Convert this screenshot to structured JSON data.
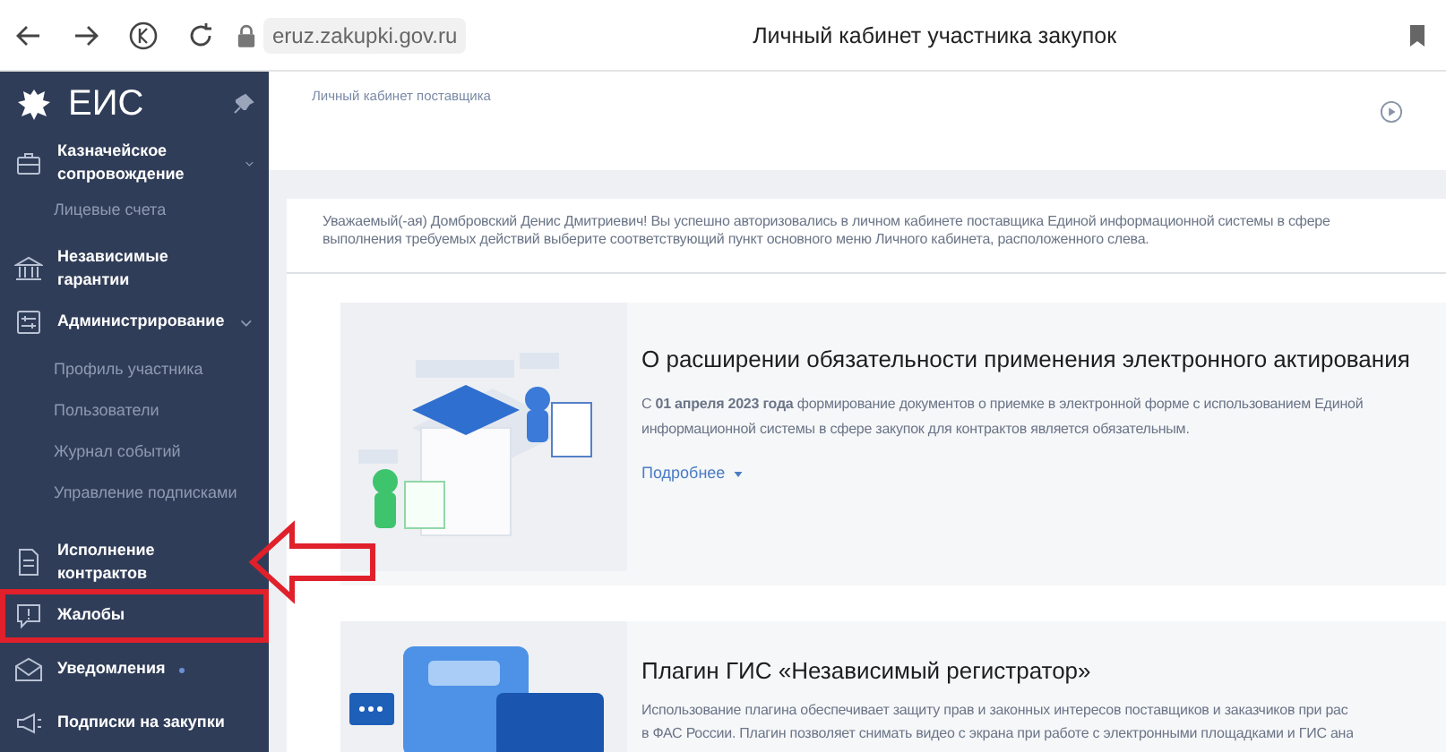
{
  "browser": {
    "url": "eruz.zakupki.gov.ru",
    "title": "Личный кабинет участника закупок"
  },
  "sidebar": {
    "logo": "ЕИС",
    "items": [
      {
        "label": "Казначейское сопровождение",
        "expanded": true,
        "children": [
          {
            "label": "Лицевые счета"
          }
        ]
      },
      {
        "label": "Независимые гарантии"
      },
      {
        "label": "Администрирование",
        "expanded": true,
        "children": [
          {
            "label": "Профиль участника"
          },
          {
            "label": "Пользователи"
          },
          {
            "label": "Журнал событий"
          },
          {
            "label": "Управление подписками"
          }
        ]
      },
      {
        "label": "Исполнение контрактов"
      },
      {
        "label": "Жалобы",
        "highlighted": true
      },
      {
        "label": "Уведомления",
        "unread": true
      },
      {
        "label": "Подписки на закупки"
      }
    ]
  },
  "breadcrumb": "Личный кабинет поставщика",
  "welcome": [
    "Уважаемый(-ая) Домбровский Денис Дмитриевич! Вы успешно авторизовались в личном кабинете поставщика Единой информационной системы в сфере",
    "выполнения требуемых действий выберите соответствующий пункт основного меню Личного кабинета, расположенного слева."
  ],
  "news": [
    {
      "title": "О расширении обязательности применения электронного актирования",
      "text": [
        "С **01 апреля 2023 года** формирование документов о приемке в электронной форме с использованием Единой",
        "информационной системы в сфере закупок для контрактов является обязательным."
      ],
      "more": "Подробнее"
    },
    {
      "title": "Плагин ГИС «Независимый регистратор»",
      "text": [
        "Использование плагина обеспечивает защиту прав и законных интересов поставщиков и заказчиков при рас",
        "в ФАС России. Плагин позволяет снимать видео с экрана при работе с электронными площадками и ГИС ана"
      ]
    }
  ]
}
